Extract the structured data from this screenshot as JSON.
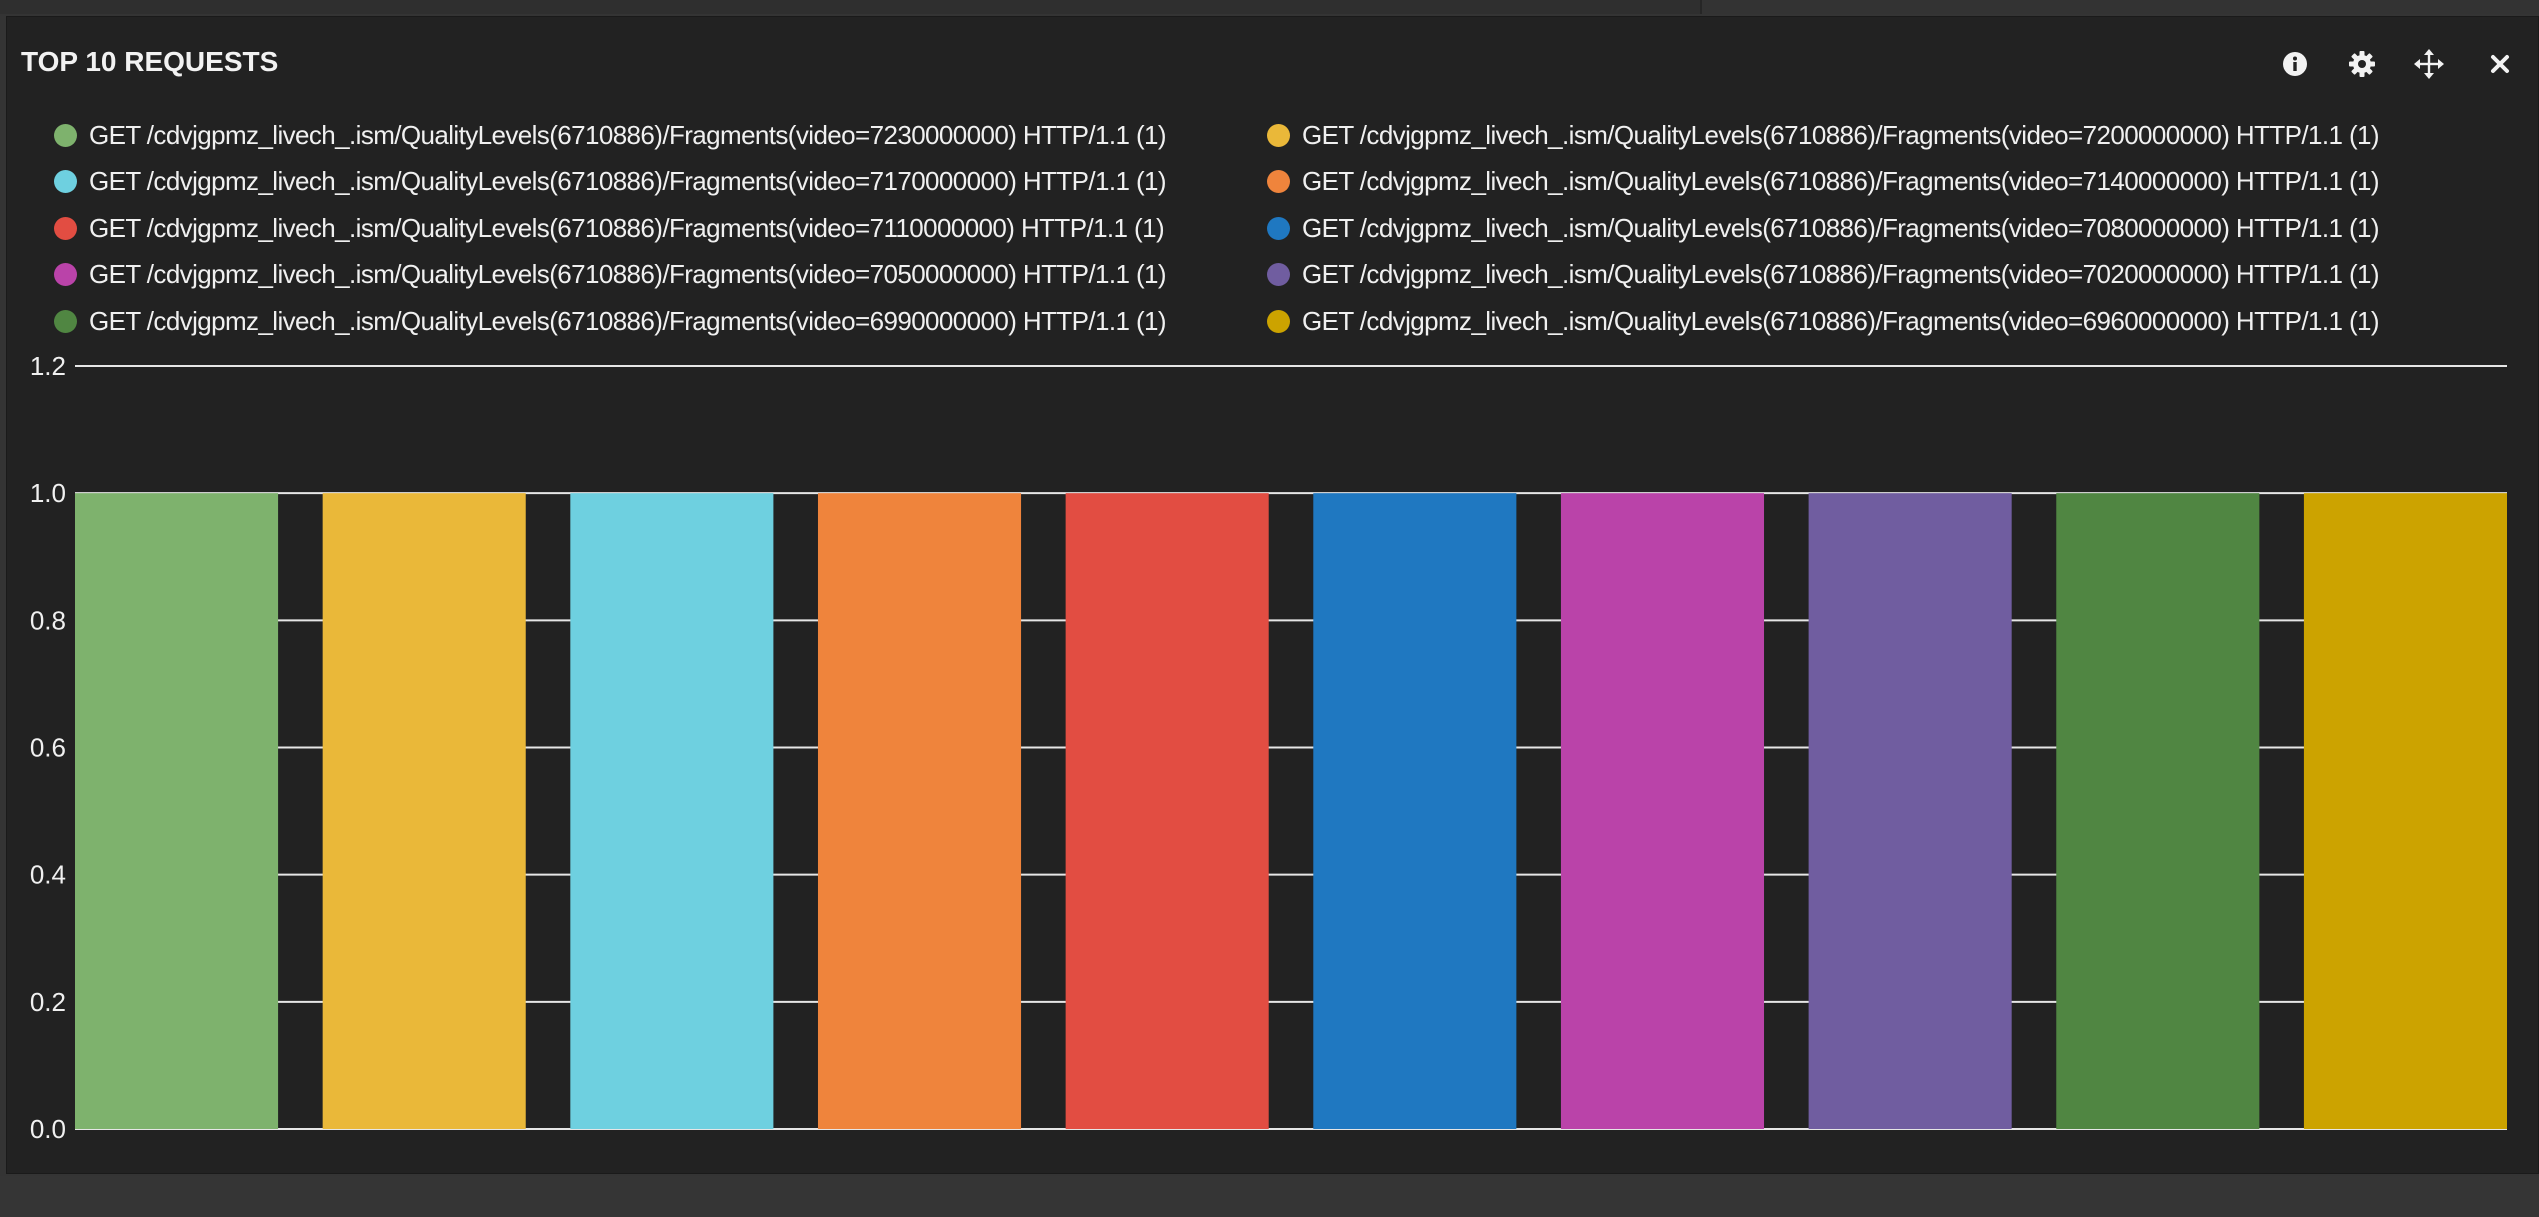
{
  "panel": {
    "title": "TOP 10 REQUESTS",
    "tools": [
      {
        "name": "info-icon"
      },
      {
        "name": "gear-icon"
      },
      {
        "name": "move-icon"
      },
      {
        "name": "close-icon"
      }
    ]
  },
  "colors": {
    "panel_bg": "#222222",
    "page_bg": "#343434",
    "text": "#f0f0f0",
    "grid": "#e6e6e6"
  },
  "chart_data": {
    "type": "bar",
    "title": "TOP 10 REQUESTS",
    "xlabel": "",
    "ylabel": "",
    "ylim": [
      0,
      1.2
    ],
    "yticks": [
      "0.0",
      "0.2",
      "0.4",
      "0.6",
      "0.8",
      "1.0",
      "1.2"
    ],
    "grid": true,
    "legend_placement": "top",
    "series": [
      {
        "name": "GET /cdvjgpmz_livech_.ism/QualityLevels(6710886)/Fragments(video=7230000000) HTTP/1.1 (1)",
        "value": 1,
        "color": "#7eb26d"
      },
      {
        "name": "GET /cdvjgpmz_livech_.ism/QualityLevels(6710886)/Fragments(video=7200000000) HTTP/1.1 (1)",
        "value": 1,
        "color": "#eab839"
      },
      {
        "name": "GET /cdvjgpmz_livech_.ism/QualityLevels(6710886)/Fragments(video=7170000000) HTTP/1.1 (1)",
        "value": 1,
        "color": "#6ed0e0"
      },
      {
        "name": "GET /cdvjgpmz_livech_.ism/QualityLevels(6710886)/Fragments(video=7140000000) HTTP/1.1 (1)",
        "value": 1,
        "color": "#ef843c"
      },
      {
        "name": "GET /cdvjgpmz_livech_.ism/QualityLevels(6710886)/Fragments(video=7110000000) HTTP/1.1 (1)",
        "value": 1,
        "color": "#e24d42"
      },
      {
        "name": "GET /cdvjgpmz_livech_.ism/QualityLevels(6710886)/Fragments(video=7080000000) HTTP/1.1 (1)",
        "value": 1,
        "color": "#1f78c1"
      },
      {
        "name": "GET /cdvjgpmz_livech_.ism/QualityLevels(6710886)/Fragments(video=7050000000) HTTP/1.1 (1)",
        "value": 1,
        "color": "#ba43a9"
      },
      {
        "name": "GET /cdvjgpmz_livech_.ism/QualityLevels(6710886)/Fragments(video=7020000000) HTTP/1.1 (1)",
        "value": 1,
        "color": "#705da0"
      },
      {
        "name": "GET /cdvjgpmz_livech_.ism/QualityLevels(6710886)/Fragments(video=6990000000) HTTP/1.1 (1)",
        "value": 1,
        "color": "#508642"
      },
      {
        "name": "GET /cdvjgpmz_livech_.ism/QualityLevels(6710886)/Fragments(video=6960000000) HTTP/1.1 (1)",
        "value": 1,
        "color": "#cca300"
      }
    ]
  }
}
